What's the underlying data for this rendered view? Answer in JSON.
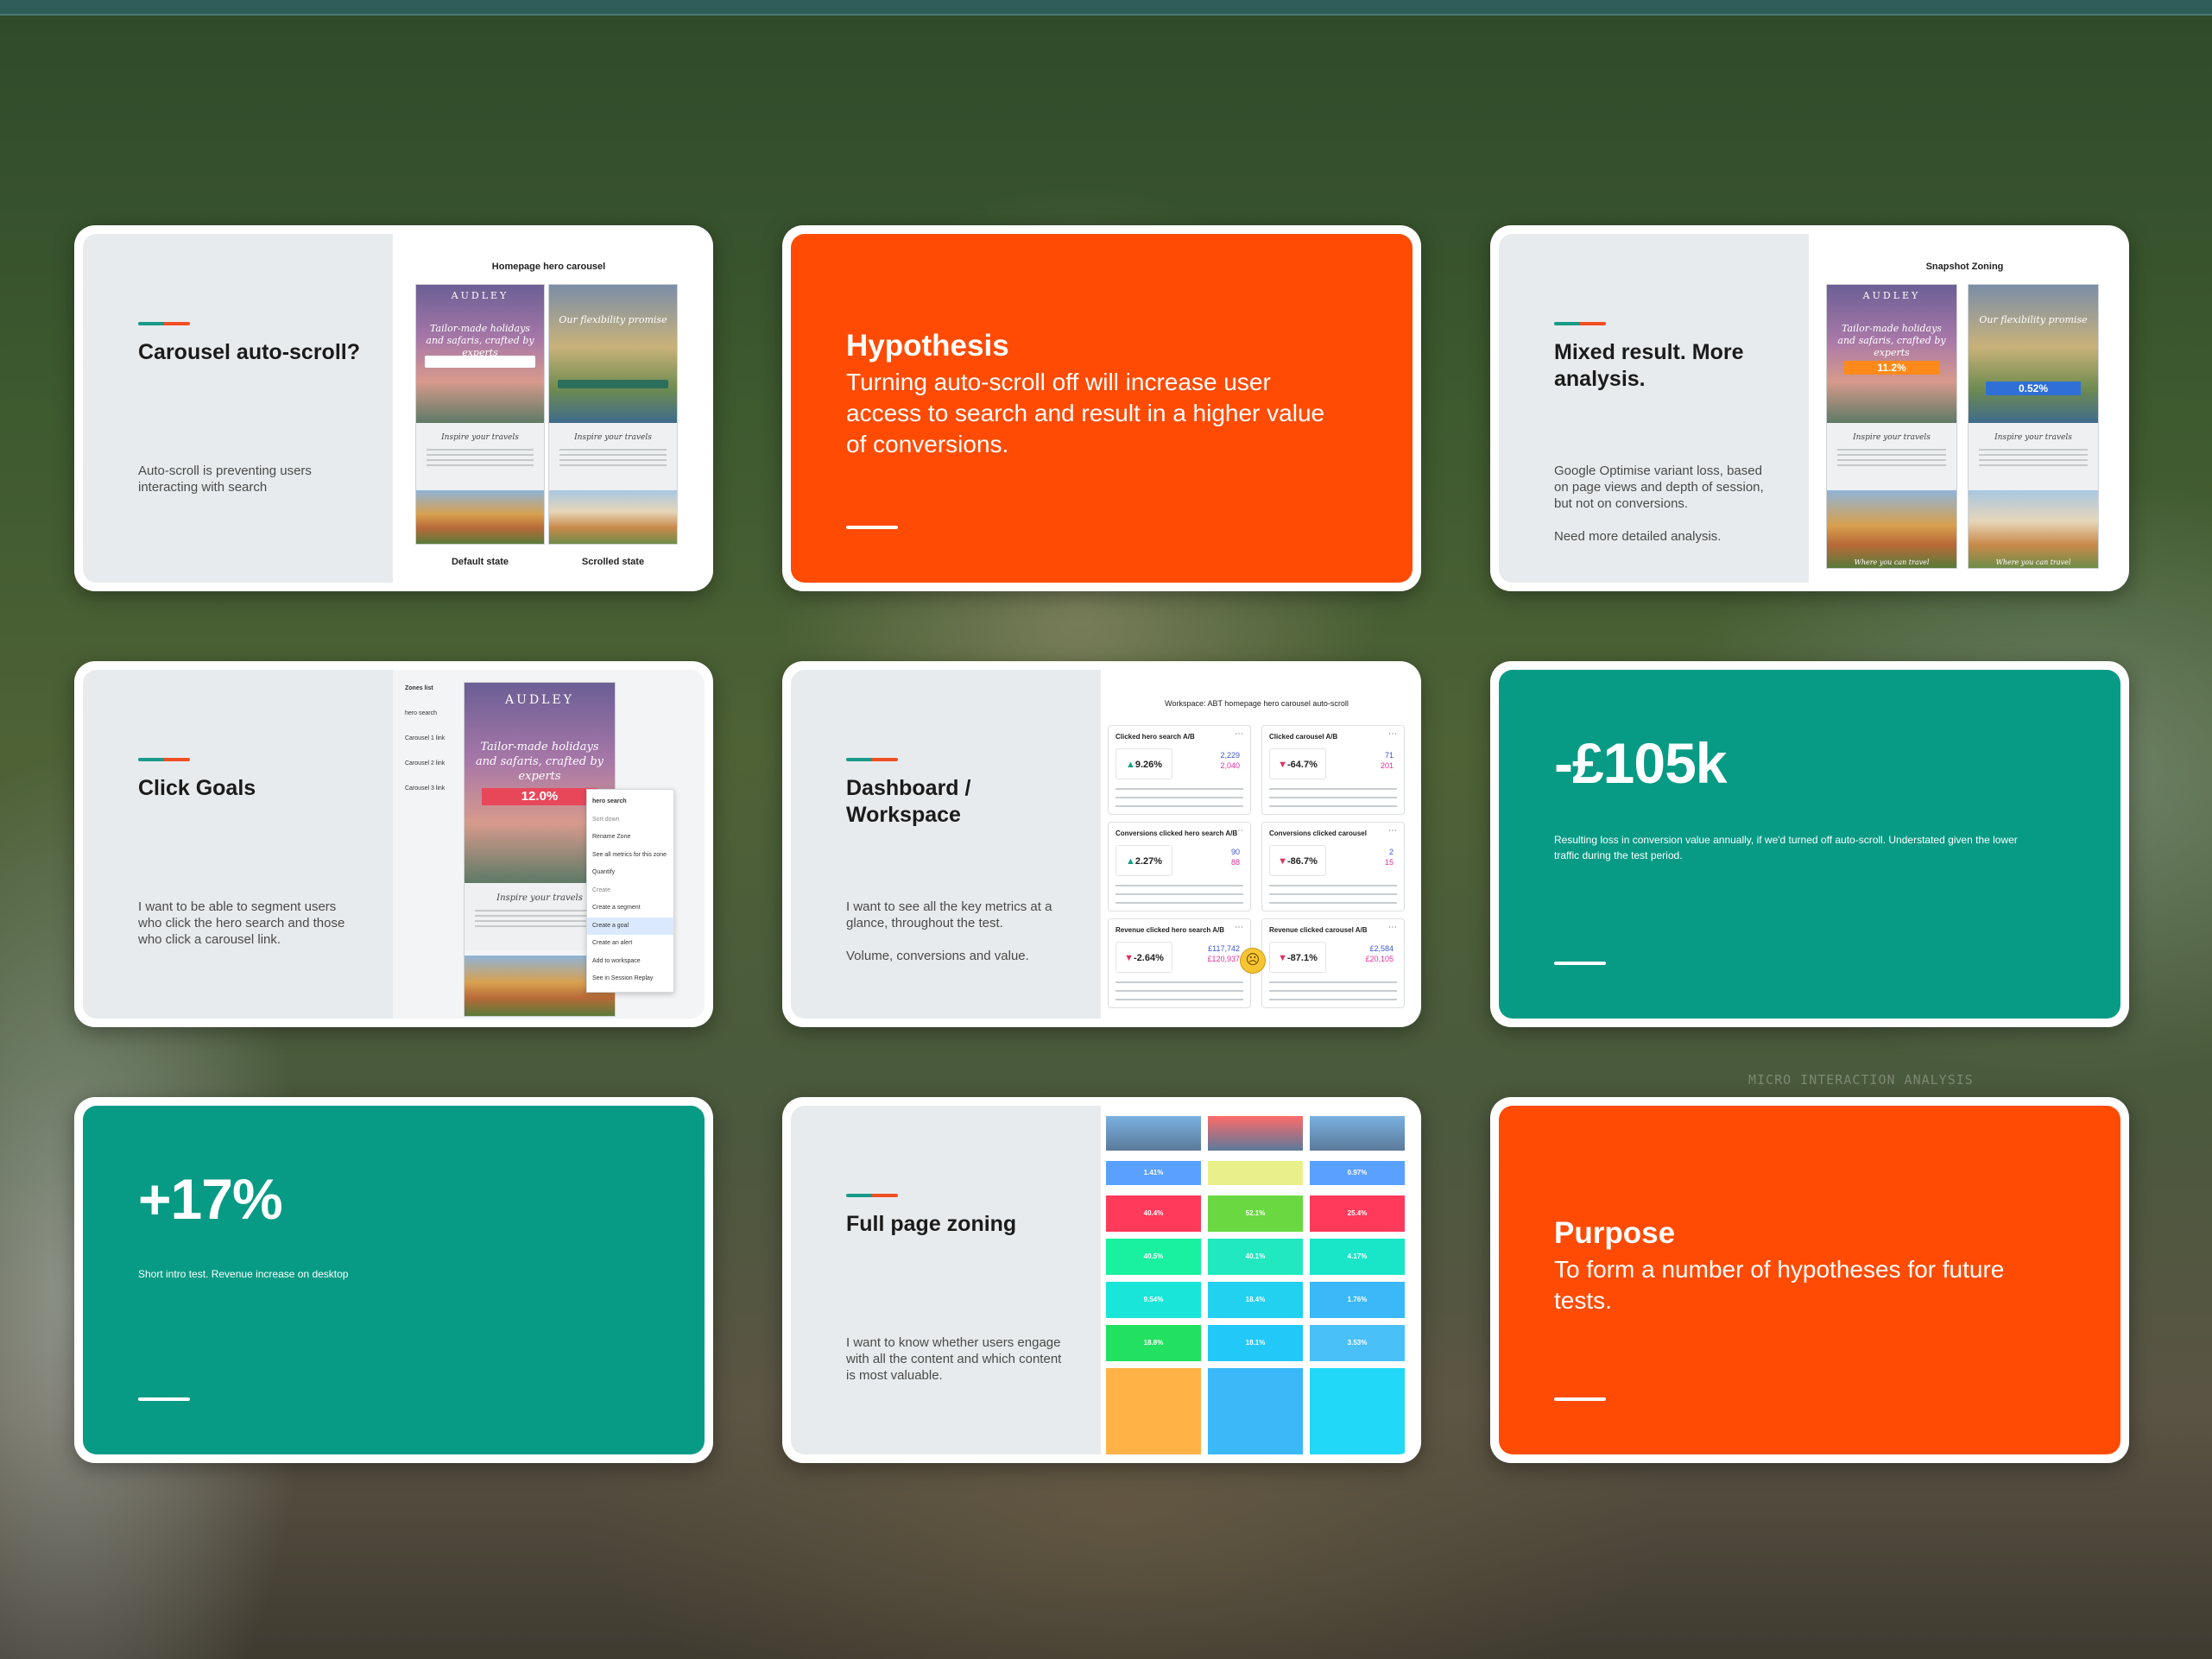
{
  "background": {
    "caption": "MICRO INTERACTION ANALYSIS"
  },
  "colors": {
    "orange": "#ff4b03",
    "teal": "#079b85",
    "panel_grey": "#e8ebed"
  },
  "cards": {
    "carousel": {
      "title": "Carousel auto-scroll?",
      "desc": "Auto-scroll is preventing users interacting with search",
      "screen_label": "Homepage hero carousel",
      "default_label": "Default state",
      "scrolled_label": "Scrolled state",
      "phone": {
        "logo": "AUDLEY",
        "tagline": "Tailor-made holidays and safaris, crafted by experts",
        "alt_tagline": "Our flexibility promise",
        "section_title": "Inspire your travels"
      }
    },
    "hypothesis": {
      "title": "Hypothesis",
      "body": "Turning auto-scroll off will increase user access to search and result in a higher value of conversions."
    },
    "mixed": {
      "title": "Mixed result. More analysis.",
      "desc1": "Google Optimise variant loss, based on page views and depth of session, but not on conversions.",
      "desc2": "Need more detailed analysis.",
      "screen_label": "Snapshot Zoning",
      "pct_a": "11.2%",
      "pct_b": "0.52%",
      "photo_caption": "Where you can travel"
    },
    "click_goals": {
      "title": "Click Goals",
      "desc": "I want to be able to segment users who click the hero search and those who click a carousel link.",
      "zones_title": "Zones list",
      "zones": [
        "hero search",
        "Carousel 1 link",
        "Carousel 2 link",
        "Carousel 3 link"
      ],
      "pct": "12.0%",
      "menu_items": [
        "hero search",
        "Sort down",
        "Rename Zone",
        "See all metrics for this zone",
        "Quantify",
        "Create",
        "Create a segment",
        "Create a goal",
        "Create an alert",
        "Add to workspace",
        "See in Session Replay"
      ]
    },
    "dashboard": {
      "title": "Dashboard / Workspace",
      "desc1": "I want to see all the key metrics at a glance, throughout the test.",
      "desc2": "Volume, conversions and value.",
      "workspace_label": "Workspace: ABT homepage hero carousel auto-scroll",
      "metrics": [
        {
          "title": "Clicked hero search A/B",
          "value": "9.26%",
          "dir": "up",
          "a": "2,229",
          "b": "2,040"
        },
        {
          "title": "Clicked carousel A/B",
          "value": "-64.7%",
          "dir": "down",
          "a": "71",
          "b": "201"
        },
        {
          "title": "Conversions clicked hero search A/B",
          "value": "2.27%",
          "dir": "up",
          "a": "90",
          "b": "88"
        },
        {
          "title": "Conversions clicked carousel",
          "value": "-86.7%",
          "dir": "down",
          "a": "2",
          "b": "15"
        },
        {
          "title": "Revenue clicked hero search A/B",
          "value": "-2.64%",
          "dir": "down",
          "a": "£117,742",
          "b": "£120,937"
        },
        {
          "title": "Revenue clicked carousel A/B",
          "value": "-87.1%",
          "dir": "down",
          "a": "£2,584",
          "b": "£20,105"
        }
      ]
    },
    "loss": {
      "big": "-£105k",
      "small": "Resulting loss in conversion value annually, if we'd turned off auto-scroll. Understated given the lower traffic during the test period."
    },
    "increase": {
      "big": "+17%",
      "small": "Short intro test. Revenue increase on desktop"
    },
    "zoning": {
      "title": "Full page zoning",
      "desc": "I want to know whether users engage with all the content and which content is most valuable.",
      "columns": [
        [
          "1.41%",
          "40.4%",
          "40.5%",
          "9.54%",
          "18.8%",
          ""
        ],
        [
          "",
          "52.1%",
          "40.1%",
          "18.4%",
          "18.1%",
          ""
        ],
        [
          "0.97%",
          "25.4%",
          "4.17%",
          "1.76%",
          "3.53%",
          ""
        ]
      ]
    },
    "purpose": {
      "title": "Purpose",
      "body": "To form a number of hypotheses for future tests."
    }
  }
}
